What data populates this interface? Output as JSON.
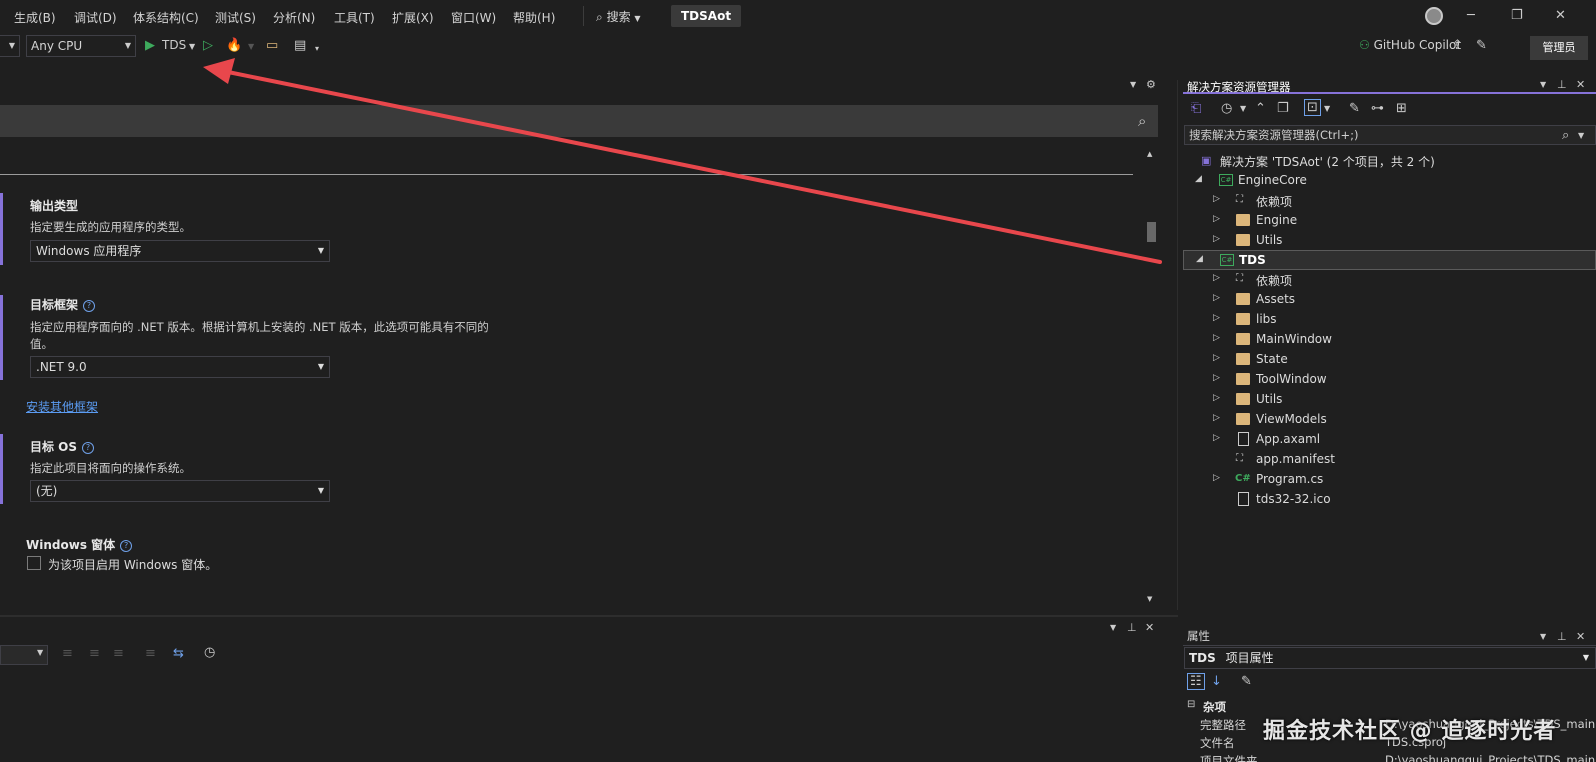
{
  "menu": {
    "items": [
      "生成(B)",
      "调试(D)",
      "体系结构(C)",
      "测试(S)",
      "分析(N)",
      "工具(T)",
      "扩展(X)",
      "窗口(W)",
      "帮助(H)"
    ],
    "search_label": "搜索",
    "solution_name": "TDSAot"
  },
  "toolbar": {
    "platform": "Any CPU",
    "start_target": "TDS",
    "copilot_label": "GitHub Copilot",
    "admin_label": "管理员"
  },
  "project_props": {
    "output_type": {
      "title": "输出类型",
      "desc": "指定要生成的应用程序的类型。",
      "value": "Windows 应用程序"
    },
    "target_framework": {
      "title": "目标框架",
      "desc_line1": "指定应用程序面向的 .NET 版本。根据计算机上安装的 .NET 版本，此选项可能具有不同的",
      "desc_line2": "值。",
      "value": ".NET 9.0"
    },
    "install_link": "安装其他框架",
    "target_os": {
      "title": "目标 OS",
      "desc": "指定此项目将面向的操作系统。",
      "value": "(无)"
    },
    "winforms": {
      "title": "Windows 窗体",
      "checkbox_label": "为该项目启用 Windows 窗体。",
      "checked": false
    }
  },
  "solution_explorer": {
    "title": "解决方案资源管理器",
    "search_placeholder": "搜索解决方案资源管理器(Ctrl+;)",
    "tree": [
      {
        "label": "解决方案 'TDSAot' (2 个项目，共 2 个)",
        "icon": "solution-icon",
        "level": 0,
        "arrow": ""
      },
      {
        "label": "EngineCore",
        "icon": "csproj-icon",
        "level": 1,
        "arrow": "expanded"
      },
      {
        "label": "依赖项",
        "icon": "dependencies-icon",
        "level": 2,
        "arrow": "collapsed"
      },
      {
        "label": "Engine",
        "icon": "folder-icon",
        "level": 2,
        "arrow": "collapsed"
      },
      {
        "label": "Utils",
        "icon": "folder-icon",
        "level": 2,
        "arrow": "collapsed"
      },
      {
        "label": "TDS",
        "icon": "csproj-icon",
        "level": 1,
        "arrow": "expanded",
        "selected": true
      },
      {
        "label": "依赖项",
        "icon": "dependencies-icon",
        "level": 2,
        "arrow": "collapsed"
      },
      {
        "label": "Assets",
        "icon": "folder-icon",
        "level": 2,
        "arrow": "collapsed"
      },
      {
        "label": "libs",
        "icon": "folder-icon",
        "level": 2,
        "arrow": "collapsed"
      },
      {
        "label": "MainWindow",
        "icon": "folder-icon",
        "level": 2,
        "arrow": "collapsed"
      },
      {
        "label": "State",
        "icon": "folder-icon",
        "level": 2,
        "arrow": "collapsed"
      },
      {
        "label": "ToolWindow",
        "icon": "folder-icon",
        "level": 2,
        "arrow": "collapsed"
      },
      {
        "label": "Utils",
        "icon": "folder-icon",
        "level": 2,
        "arrow": "collapsed"
      },
      {
        "label": "ViewModels",
        "icon": "folder-icon",
        "level": 2,
        "arrow": "collapsed"
      },
      {
        "label": "App.axaml",
        "icon": "file-icon",
        "level": 2,
        "arrow": "collapsed"
      },
      {
        "label": "app.manifest",
        "icon": "manifest-icon",
        "level": 2,
        "arrow": ""
      },
      {
        "label": "Program.cs",
        "icon": "csharp-icon",
        "level": 2,
        "arrow": "collapsed"
      },
      {
        "label": "tds32-32.ico",
        "icon": "image-file-icon",
        "level": 2,
        "arrow": ""
      }
    ]
  },
  "properties": {
    "title": "属性",
    "object": "TDS",
    "object_type": "项目属性",
    "category": "杂项",
    "rows": [
      {
        "name": "完整路径",
        "value": "D:\\yaoshuangqui_Projects\\TDS_main"
      },
      {
        "name": "文件名",
        "value": "TDS.csproj"
      },
      {
        "name": "项目文件夹",
        "value": "D:\\yaoshuangqui_Projects\\TDS_main"
      }
    ]
  },
  "watermark": "掘金技术社区 @ 追逐时光者",
  "colors": {
    "accent": "#8672d9",
    "arrow": "#e8474c",
    "folder": "#dcb67a",
    "csharp": "#3eaa5d",
    "link": "#5b9cf3"
  }
}
